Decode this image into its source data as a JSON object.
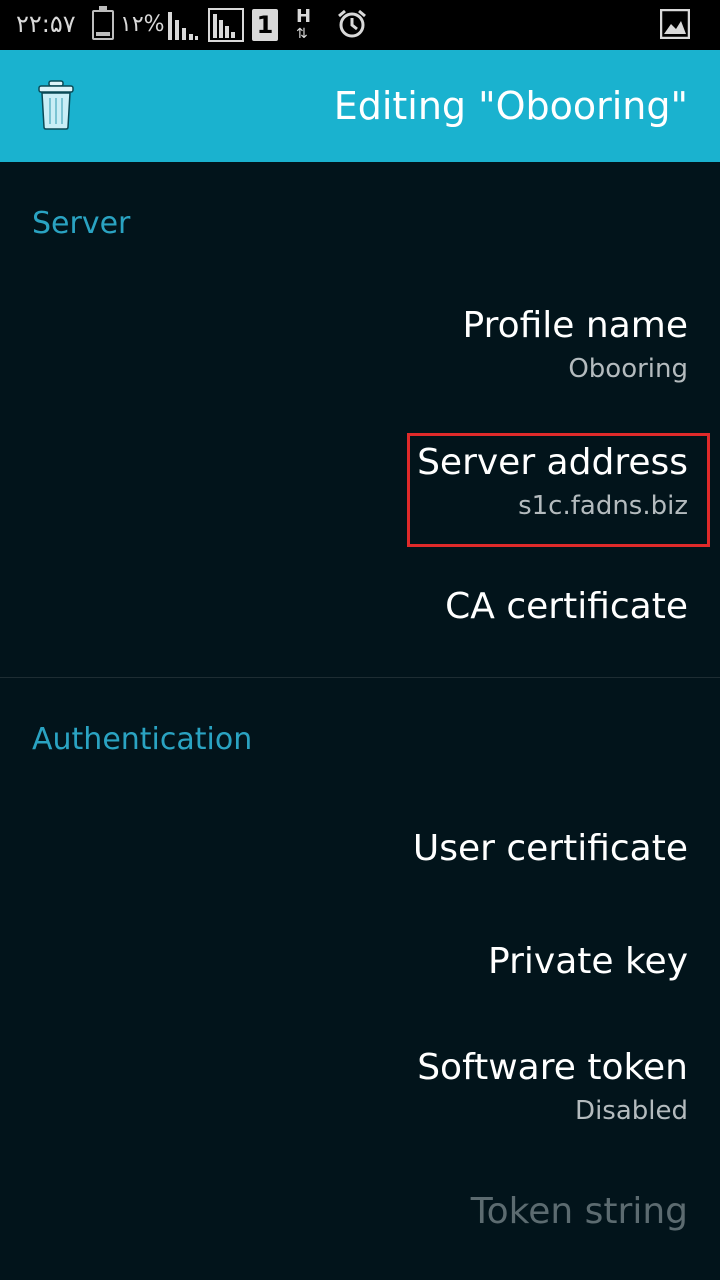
{
  "status_bar": {
    "time": "۲۲:۵۷",
    "battery_percent": "۱۲%",
    "sim_slot": "1",
    "network_type": "H",
    "network_arrows": "⇅"
  },
  "app_bar": {
    "title": "Editing \"Obooring\""
  },
  "sections": {
    "server": {
      "header": "Server",
      "profile_name": {
        "title": "Profile name",
        "summary": "Obooring"
      },
      "server_address": {
        "title": "Server address",
        "summary": "s1c.fadns.biz"
      },
      "ca_certificate": {
        "title": "CA certificate"
      }
    },
    "authentication": {
      "header": "Authentication",
      "user_certificate": {
        "title": "User certificate"
      },
      "private_key": {
        "title": "Private key"
      },
      "software_token": {
        "title": "Software token",
        "summary": "Disabled"
      },
      "token_string": {
        "title": "Token string"
      }
    }
  },
  "colors": {
    "app_bar": "#1ab2cf",
    "background": "#02141b",
    "section_header": "#2aa3c2",
    "highlight_box": "#e02a2a"
  }
}
